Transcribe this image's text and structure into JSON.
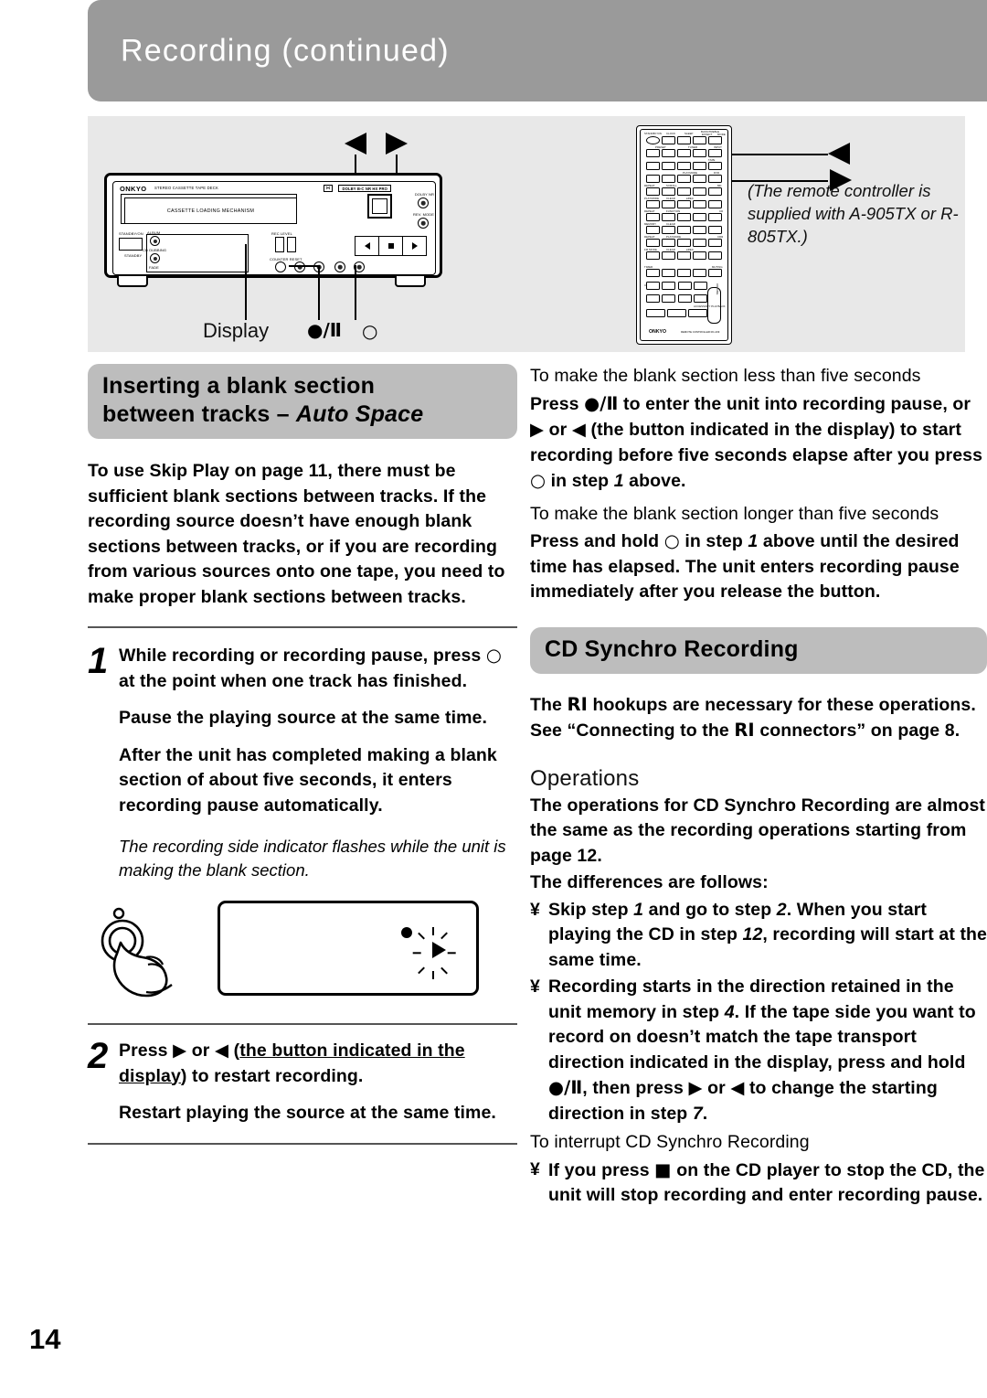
{
  "header": {
    "title": "Recording (continued)"
  },
  "figure": {
    "deck": {
      "brand": "ONKYO",
      "brand_sub": "STEREO CASSETTE TAPE DECK",
      "dolby": "DOLBY  B-C  NR  HX PRO",
      "cassette_label": "CASSETTE LOADING MECHANISM",
      "standby_on": "STANDBY/ON",
      "standby": "STANDBY",
      "album": "ALBUM",
      "cd_dubbing": "CD DUBBING",
      "fade": "FADE",
      "rec_level": "REC LEVEL",
      "counter_reset": "COUNTER RESET",
      "dolby_nr": "DOLBY NR",
      "rev_mode": "REV. MODE"
    },
    "callouts": {
      "display": "Display",
      "rec_pause_symbol": "●/Ⅱ",
      "stop_symbol": "○"
    },
    "remote": {
      "brand": "ONKYO",
      "brand_sub": "REMOTE CONTROLLER      RC-439",
      "labels": {
        "standby_on": "STANDBY/ON",
        "clock": "CLOCK",
        "sleep": "SLEEP",
        "effect": "EFFECT",
        "mode": "MODE",
        "bass_treble": "BASS/TREBLE",
        "preset": "PRESET",
        "tuner": "TUNER",
        "input": "INPUT",
        "tape": "TAPE",
        "dvd": "DVD",
        "md": "MD",
        "cd": "CD",
        "cdr": "CDR",
        "repeat": "REPEAT",
        "scroll": "SCROLL",
        "playmode": "PLAYMODE",
        "clear": "CLEAR",
        "rec": "●REC",
        "function": "FUNCTION",
        "memory": "MEMORY",
        "disc": "DISC",
        "fmmode": "FM MODE",
        "muting": "MUTING",
        "up_down": "UP/DOWN",
        "volume": "VOLUME",
        "enter": "ENTER",
        "accessory_playback": "ACCESSORY PLAYBACK",
        "ten": "10/0",
        "plus10": "+/-",
        "timer": "TIMER"
      },
      "note": "(The remote controller is supplied with A-905TX or R-805TX.)"
    }
  },
  "left_column": {
    "heading_line1": "Inserting a blank section",
    "heading_line2_prefix": "between tracks – ",
    "heading_line2_italic": "Auto Space",
    "intro": "To use Skip Play on page 11, there must be sufficient blank sections between tracks. If the recording source doesn’t have enough blank sections between tracks, or if you are recording from various sources onto one tape, you need to make proper blank sections between tracks.",
    "step1": {
      "number": "1",
      "main_pre": "While recording or recording pause, press ",
      "main_symbol": "○",
      "main_post": " at the point when one track has finished.",
      "sub1": "Pause the playing source at the same time.",
      "sub2": "After the unit has completed making a blank section of about five seconds, it enters recording pause automatically."
    },
    "note_italic": "The recording side indicator flashes while the unit is making the blank section.",
    "step2": {
      "number": "2",
      "pre": "Press ",
      "sym1": "▶",
      "mid": " or ",
      "sym2": "◀",
      "paren_open": " (",
      "underlined": "the button indicated in the display",
      "paren_close": ") to restart recording.",
      "sub1": "Restart playing the source at the same time."
    }
  },
  "right_column": {
    "sub1_title": "To make the blank section less than five seconds",
    "sub1_body_a": "Press ",
    "sub1_sym_a": "●/Ⅱ",
    "sub1_body_b": " to enter the unit into recording pause, or ",
    "sub1_sym_b": "▶",
    "sub1_body_c": " or ",
    "sub1_sym_c": "◀",
    "sub1_body_d": " (the button indicated in the display) to start recording before five seconds elapse after you press ",
    "sub1_sym_d": "○",
    "sub1_body_e": " in step ",
    "sub1_step": "1",
    "sub1_body_f": " above.",
    "sub2_title": "To make the blank section longer than five seconds",
    "sub2_body_a": "Press and hold ",
    "sub2_sym_a": "○",
    "sub2_body_b": " in step ",
    "sub2_step": "1",
    "sub2_body_c": " above until the desired time has elapsed. The unit enters recording pause immediately after you release the button.",
    "cd_synchro_heading": "CD Synchro Recording",
    "cd_synchro_body_a": "The ",
    "cd_synchro_ri": "RI",
    "cd_synchro_body_b": " hookups are necessary for these operations. See “Connecting to the ",
    "cd_synchro_ri2": "RI",
    "cd_synchro_body_c": " connectors” on page 8.",
    "operations_heading": "Operations",
    "operations_body": "The operations for CD Synchro Recording are almost the same as the recording operations starting from page 12.",
    "differences_intro": "The differences are follows:",
    "bullets": [
      {
        "mark": "¥",
        "pre": "Skip step ",
        "italic1": "1",
        "mid": " and go to step ",
        "italic2": "2",
        "post": ". When you start playing the CD in step ",
        "italic3": "12",
        "tail": ", recording will start at the same time."
      },
      {
        "mark": "¥",
        "pre": "Recording starts in the direction retained in the unit memory in step ",
        "italic1": "4",
        "mid": ". If the tape side you want to record on doesn’t match the tape transport direction indicated in the display, press and hold ",
        "sym1": "●/Ⅱ",
        "mid2": ", then press ",
        "sym2": "▶",
        "mid3": " or ",
        "sym3": "◀",
        "mid4": " to change the starting direction in step ",
        "italic2": "7",
        "tail": "."
      }
    ],
    "interrupt_title": "To interrupt CD Synchro Recording",
    "interrupt_bullet": {
      "mark": "¥",
      "pre": "If you press ",
      "sym": "■",
      "post": " on the CD player to stop the CD, the unit will stop recording and enter recording pause."
    }
  },
  "footer": {
    "page_number": "14"
  },
  "colors": {
    "header_bar": "#9a9a9a",
    "figure_panel": "#e8e8e8",
    "section_head": "#bdbdbd",
    "text": "#000000"
  }
}
